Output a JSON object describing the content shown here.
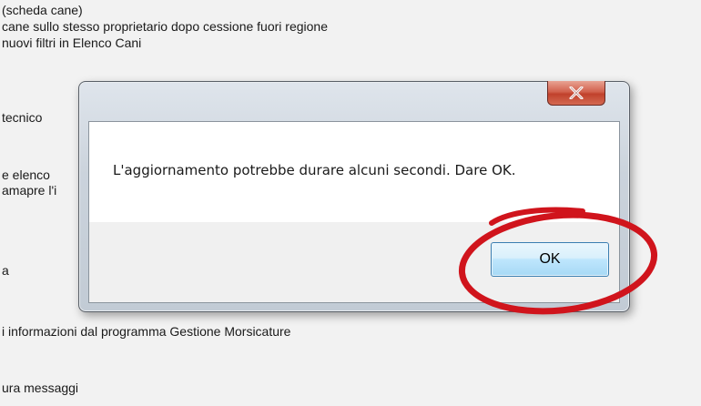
{
  "background": {
    "lines": [
      "(scheda cane)",
      "cane sullo stesso proprietario dopo cessione fuori regione",
      "nuovi filtri in Elenco Cani",
      "tecnico",
      "e elenco",
      "amapre l'i",
      "a",
      "i informazioni dal programma Gestione Morsicature",
      "ura messaggi"
    ]
  },
  "dialog": {
    "message": "L'aggiornamento potrebbe durare alcuni secondi. Dare OK.",
    "ok_label": "OK",
    "close_icon": "close-icon"
  },
  "annotation": {
    "shape": "ellipse",
    "color": "#d0141c"
  }
}
